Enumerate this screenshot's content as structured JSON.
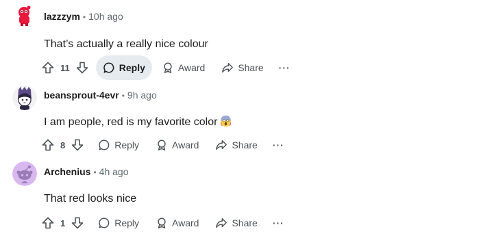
{
  "comments": [
    {
      "username": "lazzzym",
      "separator": "•",
      "time": "10h ago",
      "body": "That’s actually a really nice colour",
      "votes": "11",
      "reply_label": "Reply",
      "award_label": "Award",
      "share_label": "Share",
      "more_label": "···",
      "reply_active": true
    },
    {
      "username": "beansprout-4evr",
      "separator": "•",
      "time": "9h ago",
      "body": "I am people, red is my favorite color",
      "emoji": "face-screaming-emoji",
      "votes": "8",
      "reply_label": "Reply",
      "award_label": "Award",
      "share_label": "Share",
      "more_label": "···"
    },
    {
      "username": "Archenius",
      "separator": "•",
      "time": "4h ago",
      "body": "That red looks nice",
      "votes": "1",
      "reply_label": "Reply",
      "award_label": "Award",
      "share_label": "Share",
      "more_label": "···"
    }
  ],
  "colors": {
    "text": "#1c1c1c",
    "meta": "#5f6a70",
    "action": "#4b5358",
    "active_bg": "#e5ebee",
    "avatar1": "#e8193c",
    "avatar3": "#d9b8f0"
  }
}
